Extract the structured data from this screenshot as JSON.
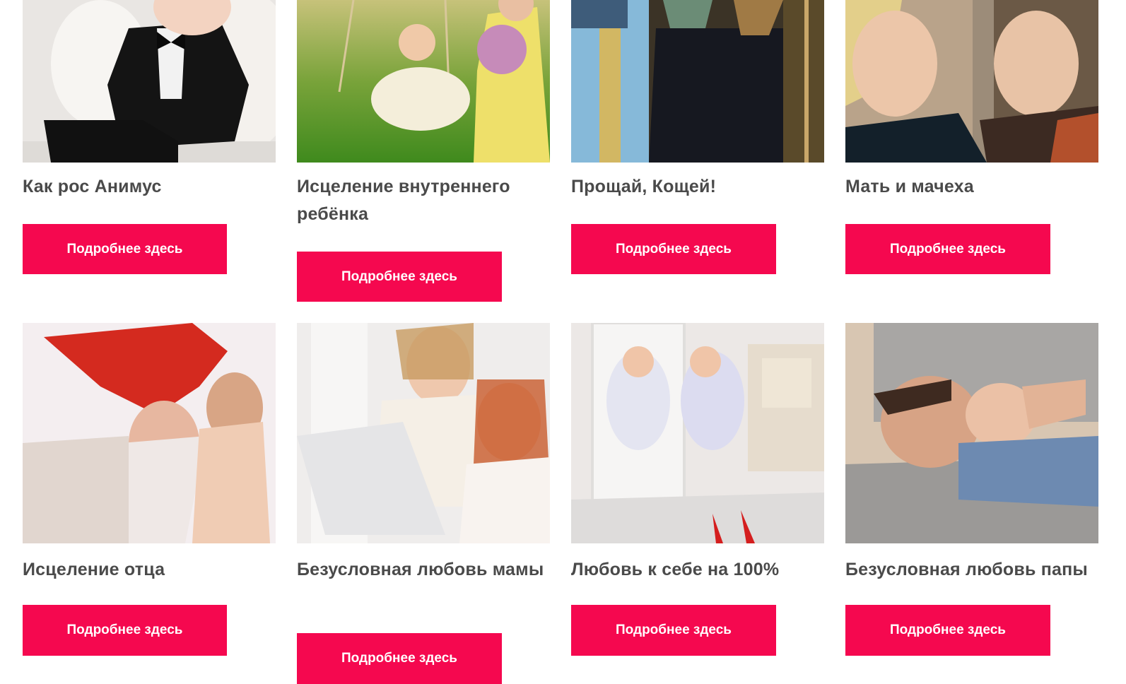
{
  "cards": [
    {
      "title": "Как рос Анимус",
      "button": "Подробнее здесь",
      "image": "baby-in-tuxedo-photo"
    },
    {
      "title": "Исцеление внутреннего ребёнка",
      "button": "Подробнее здесь",
      "image": "girl-on-swing-photo"
    },
    {
      "title": "Прощай, Кощей!",
      "button": "Подробнее здесь",
      "image": "cartoon-koschei-still"
    },
    {
      "title": "Мать и мачеха",
      "button": "Подробнее здесь",
      "image": "two-women-movie-still"
    },
    {
      "title": "Исцеление отца",
      "button": "Подробнее здесь",
      "image": "father-pillow-fight-photo"
    },
    {
      "title": "Безусловная любовь мамы",
      "button": "Подробнее здесь",
      "image": "mother-daughter-laptop-photo"
    },
    {
      "title": "Любовь к себе на 100%",
      "button": "Подробнее здесь",
      "image": "girl-at-mirror-photo"
    },
    {
      "title": "Безусловная любовь папы",
      "button": "Подробнее здесь",
      "image": "father-son-sofa-photo"
    }
  ],
  "colors": {
    "button_bg": "#f5084f",
    "button_text": "#ffffff",
    "title_text": "#4a4a4a"
  }
}
